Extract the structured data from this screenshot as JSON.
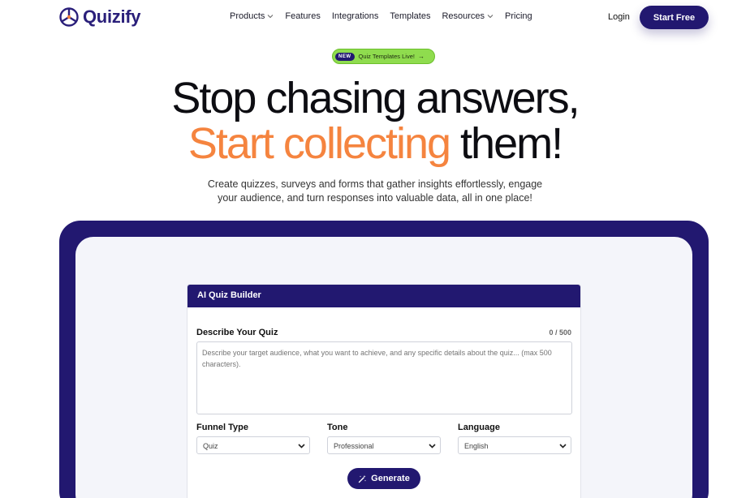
{
  "brand": {
    "name": "Quizify",
    "color": "#2a1f7a"
  },
  "nav": {
    "items": [
      {
        "label": "Products",
        "has_dropdown": true
      },
      {
        "label": "Features",
        "has_dropdown": false
      },
      {
        "label": "Integrations",
        "has_dropdown": false
      },
      {
        "label": "Templates",
        "has_dropdown": false
      },
      {
        "label": "Resources",
        "has_dropdown": true
      },
      {
        "label": "Pricing",
        "has_dropdown": false
      }
    ],
    "login": "Login",
    "cta": "Start Free"
  },
  "badge": {
    "tag": "NEW",
    "text": "Quiz Templates Live!",
    "icon": "arrow-right-icon"
  },
  "hero": {
    "line1": "Stop chasing answers,",
    "line2_highlight": "Start collecting",
    "line2_rest": " them!",
    "sub_line1": "Create quizzes, surveys and forms that gather insights effortlessly, engage",
    "sub_line2": "your audience, and turn responses into valuable data, all in one place!",
    "accent_color": "#f5843f"
  },
  "builder": {
    "title": "AI Quiz Builder",
    "describe_label": "Describe Your Quiz",
    "counter": "0 / 500",
    "placeholder": "Describe your target audience, what you want to achieve, and any specific details about the quiz... (max 500 characters).",
    "funnel": {
      "label": "Funnel Type",
      "value": "Quiz"
    },
    "tone": {
      "label": "Tone",
      "value": "Professional"
    },
    "language": {
      "label": "Language",
      "value": "English"
    },
    "generate": "Generate"
  },
  "colors": {
    "primary": "#221870",
    "badge_green": "#8fdc4e",
    "background": "#f4f5fa"
  }
}
